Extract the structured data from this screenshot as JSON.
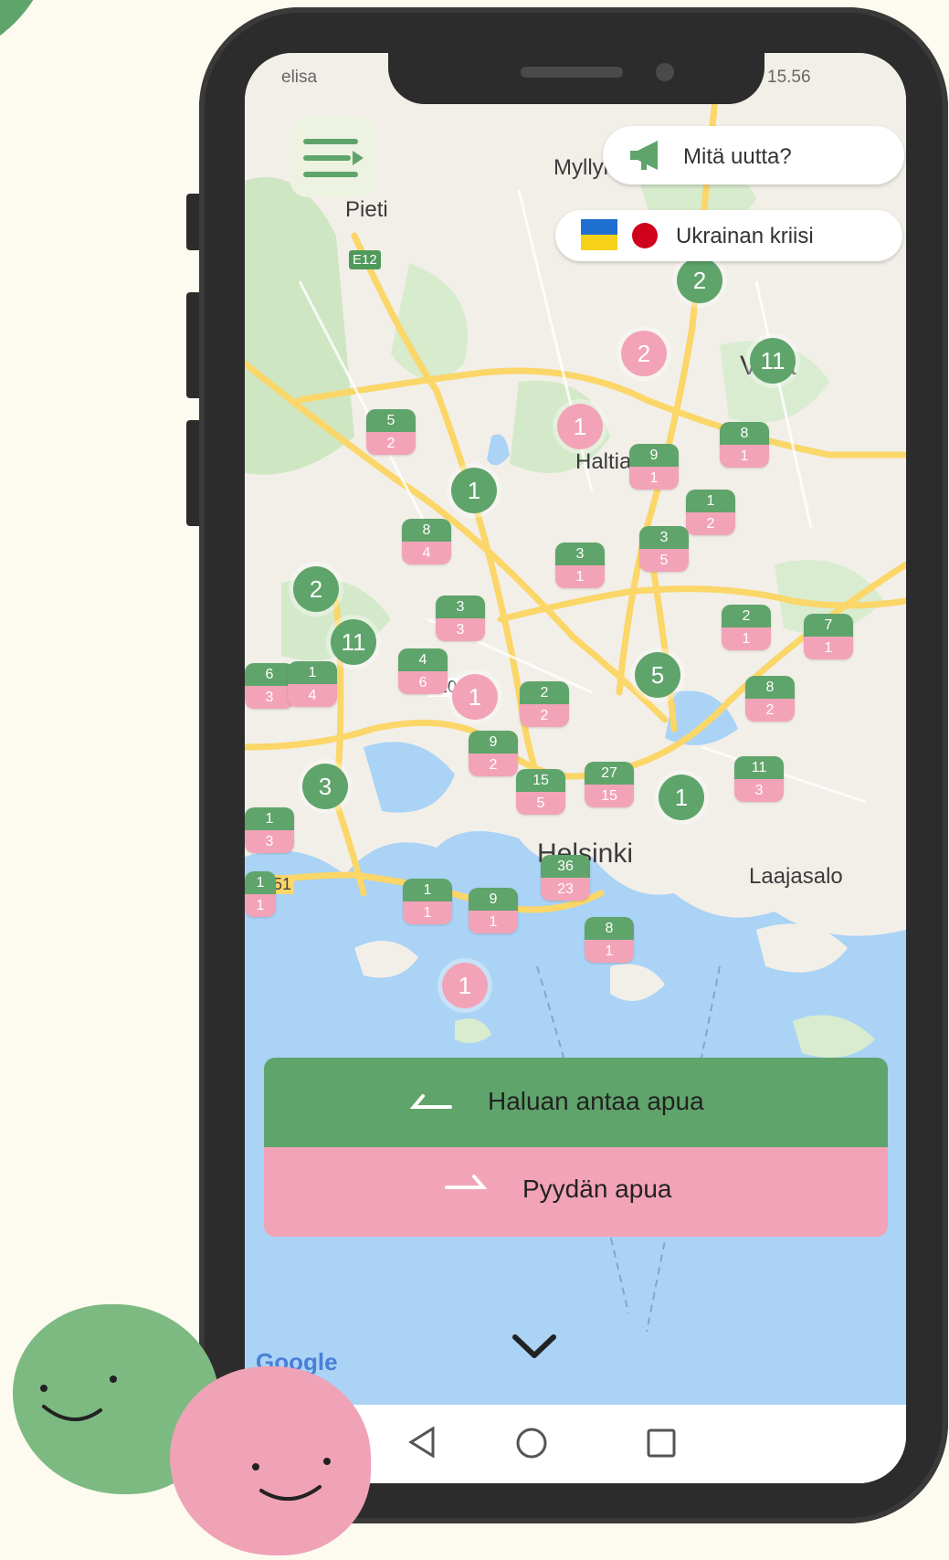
{
  "status_bar": {
    "carrier": "elisa",
    "time": "15.56"
  },
  "top_buttons": {
    "news_label": "Mitä uutta?",
    "crisis_label": "Ukrainan kriisi"
  },
  "map": {
    "places": {
      "myllyky": "Myllyky.",
      "pieti": "Pieti",
      "e12": "E12",
      "haltiala": "Haltiala",
      "vantaa": "V   aa",
      "helsinki": "Helsinki",
      "laajasalo": "Laajasalo",
      "road120": "120",
      "road51": "51"
    },
    "clusters": [
      {
        "value": "2",
        "color": "green"
      },
      {
        "value": "2",
        "color": "pink"
      },
      {
        "value": "11",
        "color": "green"
      },
      {
        "value": "1",
        "color": "pink"
      },
      {
        "value": "1",
        "color": "green"
      },
      {
        "value": "2",
        "color": "green"
      },
      {
        "value": "11",
        "color": "green"
      },
      {
        "value": "1",
        "color": "pink"
      },
      {
        "value": "5",
        "color": "green"
      },
      {
        "value": "3",
        "color": "green"
      },
      {
        "value": "1",
        "color": "green"
      },
      {
        "value": "1",
        "color": "pink"
      }
    ],
    "stacks": [
      {
        "give": "5",
        "ask": "2"
      },
      {
        "give": "9",
        "ask": "1"
      },
      {
        "give": "8",
        "ask": "1"
      },
      {
        "give": "1",
        "ask": "2"
      },
      {
        "give": "8",
        "ask": "4"
      },
      {
        "give": "3",
        "ask": "1"
      },
      {
        "give": "3",
        "ask": "5"
      },
      {
        "give": "3",
        "ask": "3"
      },
      {
        "give": "2",
        "ask": "1"
      },
      {
        "give": "7",
        "ask": "1"
      },
      {
        "give": "6",
        "ask": "3"
      },
      {
        "give": "1",
        "ask": "4"
      },
      {
        "give": "4",
        "ask": "6"
      },
      {
        "give": "2",
        "ask": "2"
      },
      {
        "give": "8",
        "ask": "2"
      },
      {
        "give": "9",
        "ask": "2"
      },
      {
        "give": "15",
        "ask": "5"
      },
      {
        "give": "27",
        "ask": "15"
      },
      {
        "give": "11",
        "ask": "3"
      },
      {
        "give": "1",
        "ask": "3"
      },
      {
        "give": "36",
        "ask": "23"
      },
      {
        "give": "1",
        "ask": "1"
      },
      {
        "give": "1",
        "ask": "1"
      },
      {
        "give": "9",
        "ask": "1"
      },
      {
        "give": "8",
        "ask": "1"
      }
    ]
  },
  "actions": {
    "give_help": "Haluan antaa apua",
    "ask_help": "Pyydän apua"
  },
  "google_logo": "Google",
  "colors": {
    "green": "#5fa46b",
    "pink": "#f3a3b8",
    "background": "#fdfbef"
  }
}
